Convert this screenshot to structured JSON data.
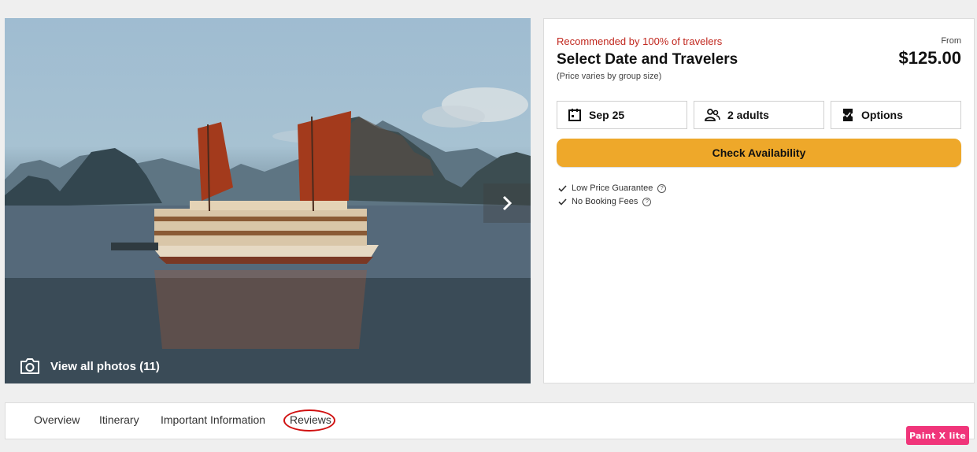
{
  "gallery": {
    "view_all_label": "View all photos (11)"
  },
  "booking": {
    "recommendation": "Recommended by 100% of travelers",
    "title": "Select Date and Travelers",
    "subtitle": "(Price varies by group size)",
    "from_label": "From",
    "price": "$125.00",
    "date_label": "Sep 25",
    "travelers_label": "2 adults",
    "options_label": "Options",
    "check_button": "Check Availability",
    "features": [
      {
        "label": "Low Price Guarantee"
      },
      {
        "label": "No Booking Fees"
      }
    ],
    "accent_color": "#eea82a",
    "recommend_color": "#c1281f"
  },
  "tabs": [
    {
      "label": "Overview"
    },
    {
      "label": "Itinerary"
    },
    {
      "label": "Important Information"
    },
    {
      "label": "Reviews"
    }
  ],
  "watermark": {
    "label": "Paint X lite"
  }
}
